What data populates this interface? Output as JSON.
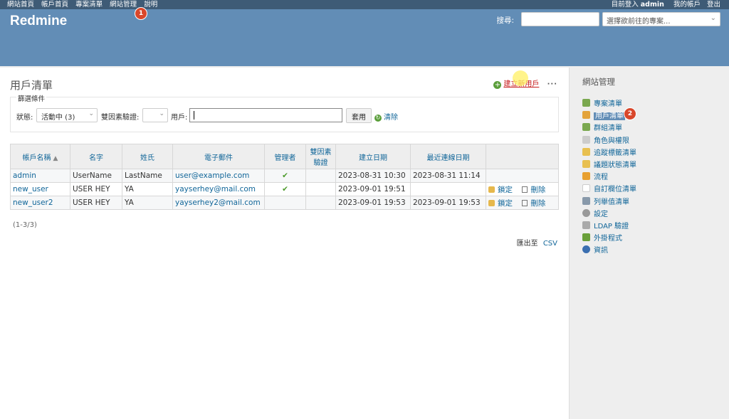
{
  "top_menu": {
    "left": [
      "網站首頁",
      "帳戶首頁",
      "專案清單",
      "網站管理",
      "說明"
    ],
    "logged_in_label": "目前登入",
    "user": "admin",
    "my_account": "我的帳戶",
    "logout": "登出"
  },
  "header": {
    "title": "Redmine",
    "search_label": "搜尋:",
    "jump_placeholder": "選擇欲前往的專案..."
  },
  "content": {
    "title": "用戶清單",
    "new_user": "建立新用戶",
    "more": "···"
  },
  "filters": {
    "legend": "篩選條件",
    "status_label": "狀態:",
    "status_value": "活動中 (3)",
    "twofa_label": "雙因素驗證:",
    "twofa_value": "",
    "user_label": "用戶:",
    "user_value": "",
    "apply": "套用",
    "clear": "清除"
  },
  "table": {
    "headers": [
      "帳戶名稱",
      "名字",
      "姓氏",
      "電子郵件",
      "管理者",
      "雙因素驗證",
      "建立日期",
      "最近連線日期",
      ""
    ],
    "rows": [
      {
        "login": "admin",
        "firstname": "UserName",
        "lastname": "LastName",
        "email": "user@example.com",
        "admin": "✔",
        "twofa": "",
        "created": "2023-08-31 10:30",
        "last_login": "2023-08-31 11:14",
        "lock": "",
        "delete": ""
      },
      {
        "login": "new_user",
        "firstname": "USER HEY",
        "lastname": "YA",
        "email": "yayserhey@mail.com",
        "admin": "✔",
        "twofa": "",
        "created": "2023-09-01 19:51",
        "last_login": "",
        "lock": "鎖定",
        "delete": "刪除"
      },
      {
        "login": "new_user2",
        "firstname": "USER HEY",
        "lastname": "YA",
        "email": "yayserhey2@mail.com",
        "admin": "",
        "twofa": "",
        "created": "2023-09-01 19:53",
        "last_login": "2023-09-01 19:53",
        "lock": "鎖定",
        "delete": "刪除"
      }
    ]
  },
  "pagination": "(1-3/3)",
  "export": {
    "label": "匯出至",
    "csv": "CSV"
  },
  "sidebar": {
    "title": "網站管理",
    "items": [
      {
        "label": "專案清單",
        "color": "#7aa84f"
      },
      {
        "label": "用戶清單",
        "color": "#e3a33b"
      },
      {
        "label": "群組清單",
        "color": "#7aa84f"
      },
      {
        "label": "角色與權限",
        "color": "#cccccc"
      },
      {
        "label": "追蹤標籤清單",
        "color": "#e8c050"
      },
      {
        "label": "議題狀態清單",
        "color": "#e8c050"
      },
      {
        "label": "流程",
        "color": "#e8a030"
      },
      {
        "label": "自訂欄位清單",
        "color": "#ffffff"
      },
      {
        "label": "列舉值清單",
        "color": "#8899aa"
      },
      {
        "label": "設定",
        "color": "#999999"
      },
      {
        "label": "LDAP 驗證",
        "color": "#aaaaaa"
      },
      {
        "label": "外掛程式",
        "color": "#6aa03a"
      },
      {
        "label": "資訊",
        "color": "#3b6fb0"
      }
    ]
  },
  "badges": [
    "1",
    "2"
  ]
}
